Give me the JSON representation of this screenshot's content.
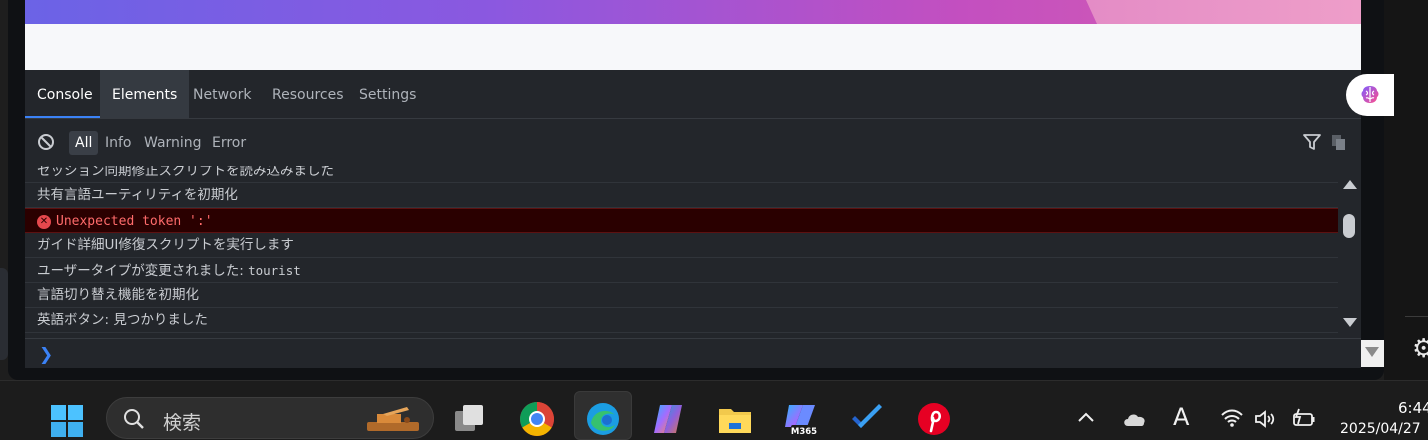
{
  "devtools": {
    "tabs": [
      {
        "label": "Console"
      },
      {
        "label": "Elements"
      },
      {
        "label": "Network"
      },
      {
        "label": "Resources"
      },
      {
        "label": "Settings"
      }
    ],
    "filters": [
      {
        "label": "All"
      },
      {
        "label": "Info"
      },
      {
        "label": "Warning"
      },
      {
        "label": "Error"
      }
    ],
    "log_rows": {
      "row0": "セッション同期修正スクリプトを読み込みました",
      "row1": "共有言語ユーティリティを初期化",
      "error_text": "Unexpected token ':'",
      "row3": "ガイド詳細UI修復スクリプトを実行します",
      "row4_text": "ユーザータイプが変更されました: ",
      "row4_value": "tourist",
      "row5": "言語切り替え機能を初期化",
      "row6": "英語ボタン: 見つかりました"
    },
    "prompt_symbol": "❯",
    "colors": {
      "accent": "#3b82f6",
      "error_bg": "#2a0000",
      "error_text": "#ff6b6b"
    }
  },
  "taskbar": {
    "search_label": "検索",
    "icons": [
      "windows-start-icon",
      "search-icon",
      "task-view-icon",
      "chrome-icon",
      "edge-icon",
      "copilot-icon",
      "file-explorer-icon",
      "m365-icon",
      "todo-icon",
      "pinterest-icon"
    ],
    "m365_badge": "M365",
    "tray_ime": "A",
    "time": "6:44",
    "date": "2025/04/27"
  }
}
